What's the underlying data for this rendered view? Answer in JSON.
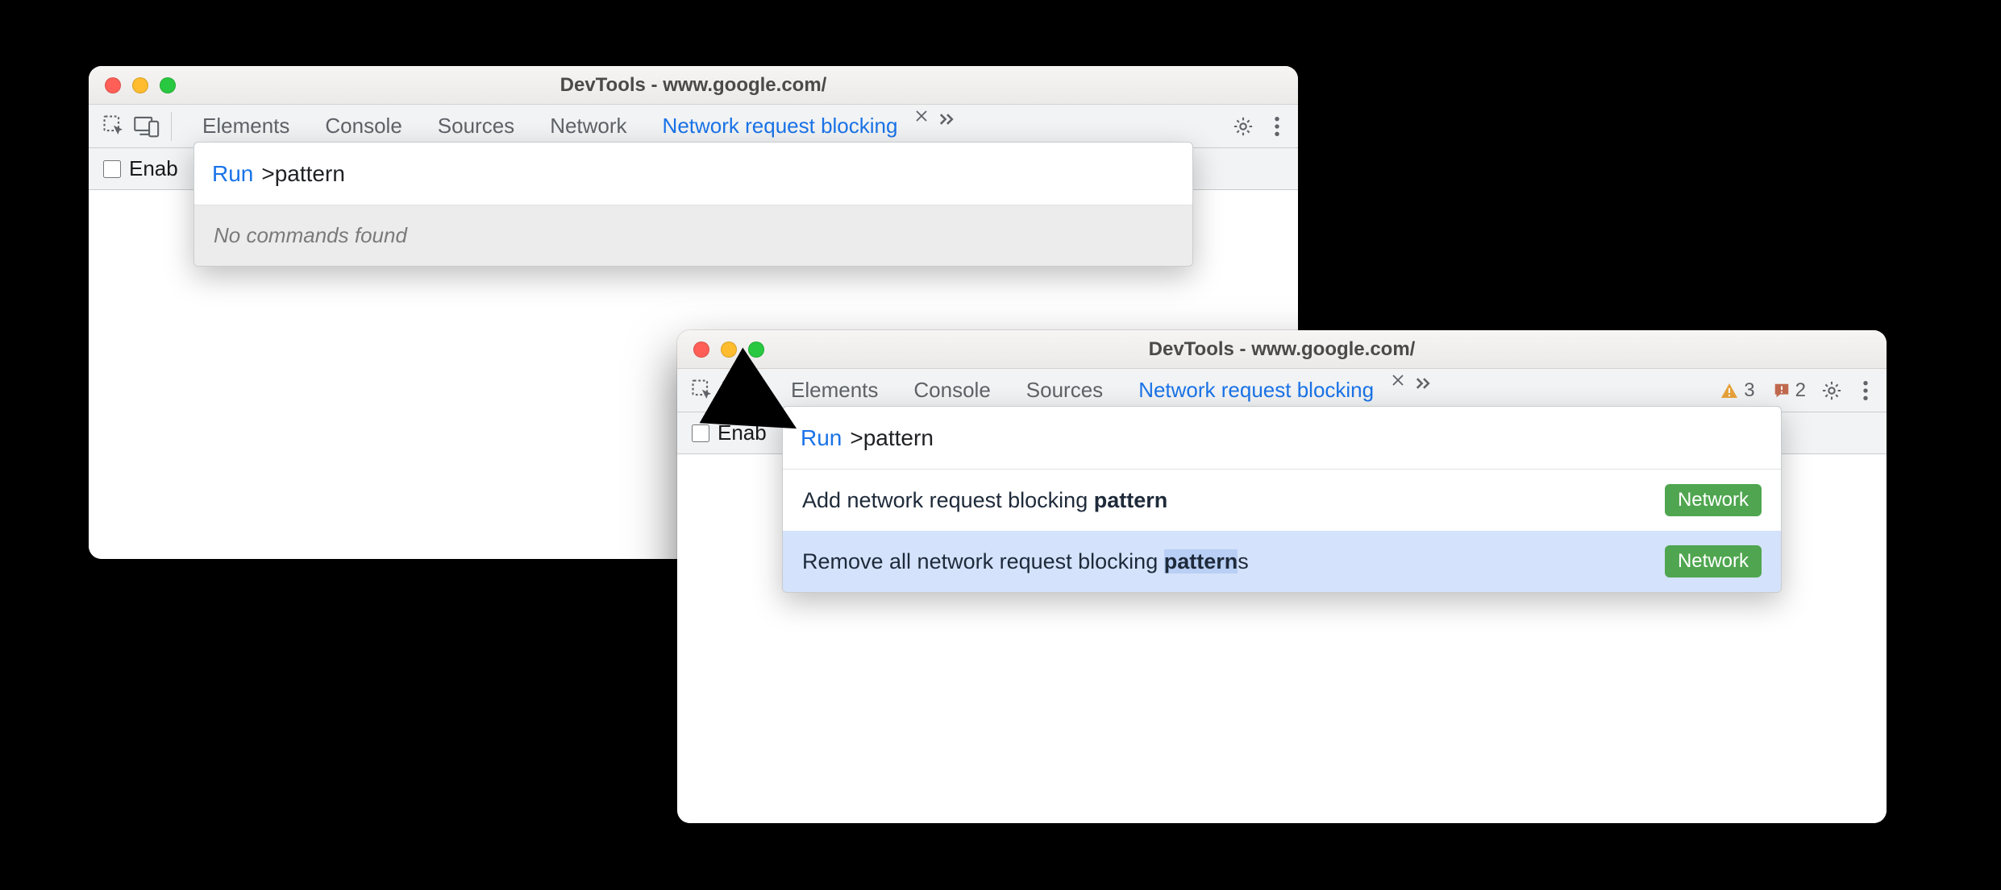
{
  "window1": {
    "title": "DevTools - www.google.com/",
    "tabs": {
      "elements": "Elements",
      "console": "Console",
      "sources": "Sources",
      "network": "Network",
      "blocking": "Network request blocking"
    },
    "subbar_label": "Enab",
    "popover": {
      "run": "Run",
      "query": ">pattern",
      "empty": "No commands found"
    }
  },
  "window2": {
    "title": "DevTools - www.google.com/",
    "tabs": {
      "elements": "Elements",
      "console": "Console",
      "sources": "Sources",
      "blocking": "Network request blocking"
    },
    "badges": {
      "warnings": "3",
      "issues": "2"
    },
    "subbar_label": "Enab",
    "popover": {
      "run": "Run",
      "query": ">pattern",
      "items": [
        {
          "prefix": "Add network request blocking ",
          "match": "pattern",
          "suffix": "",
          "tag": "Network"
        },
        {
          "prefix": "Remove all network request blocking ",
          "match": "pattern",
          "suffix": "s",
          "tag": "Network"
        }
      ]
    }
  }
}
